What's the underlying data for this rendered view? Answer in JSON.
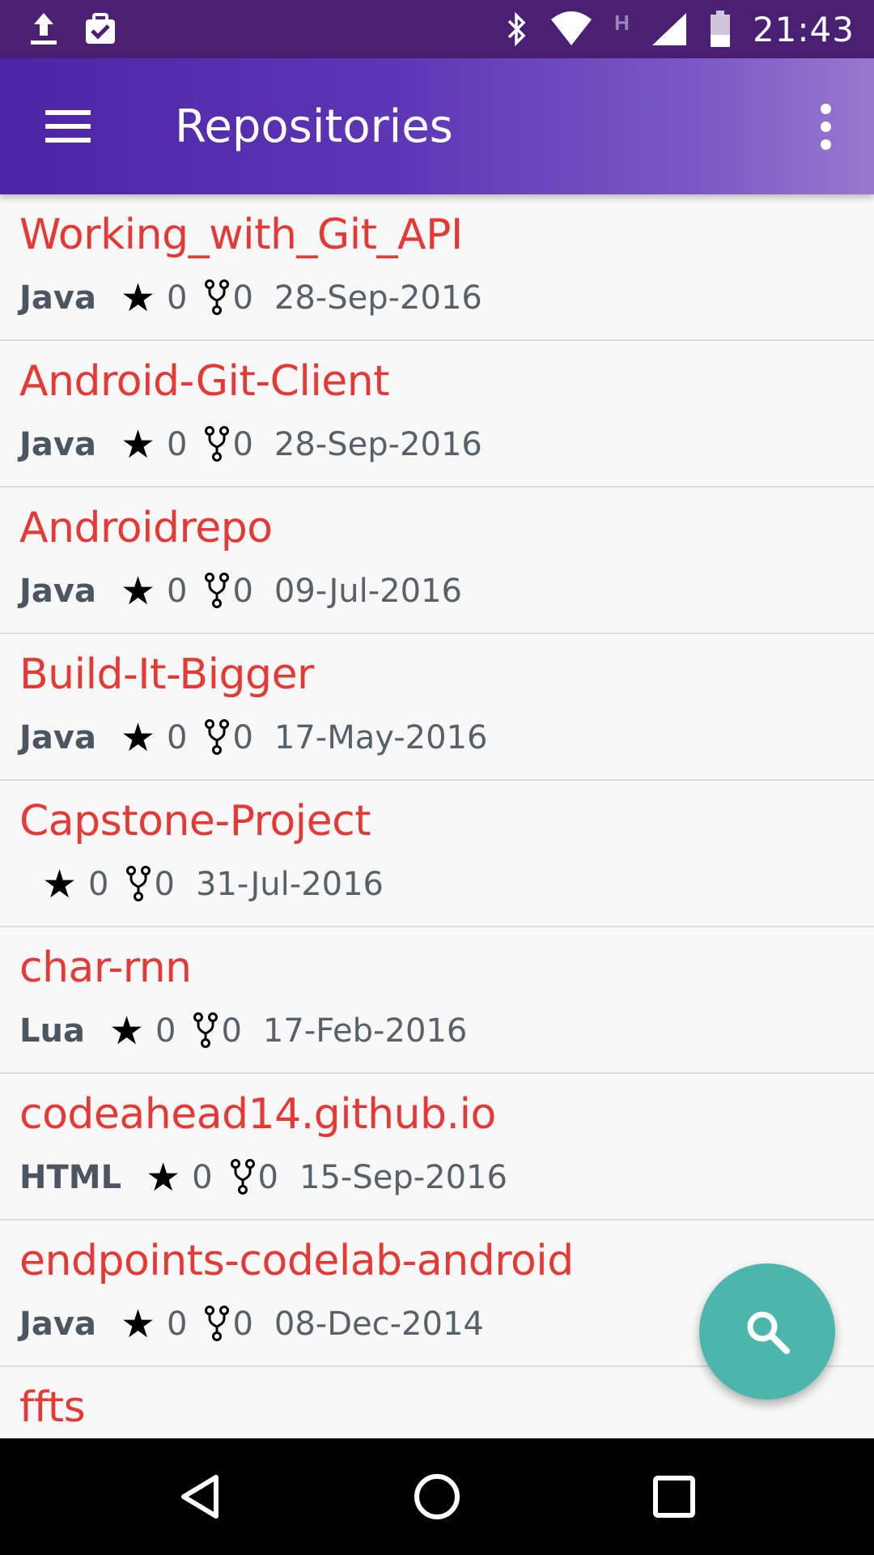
{
  "status_bar": {
    "time": "21:43",
    "left_icons": [
      "upload-icon",
      "clipboard-check-icon"
    ],
    "right_icons": [
      "bluetooth-icon",
      "wifi-icon",
      "h-network-icon",
      "signal-icon",
      "battery-icon"
    ],
    "network_type": "H"
  },
  "app_bar": {
    "title": "Repositories",
    "menu_icon": "hamburger-menu-icon",
    "overflow_icon": "more-vertical-icon",
    "gradient": [
      "#4b25a3",
      "#9878cf"
    ]
  },
  "repos": [
    {
      "name": "Working_with_Git_API",
      "language": "Java",
      "stars": "0",
      "forks": "0",
      "date": "28-Sep-2016"
    },
    {
      "name": "Android-Git-Client",
      "language": "Java",
      "stars": "0",
      "forks": "0",
      "date": "28-Sep-2016"
    },
    {
      "name": "Androidrepo",
      "language": "Java",
      "stars": "0",
      "forks": "0",
      "date": "09-Jul-2016"
    },
    {
      "name": "Build-It-Bigger",
      "language": "Java",
      "stars": "0",
      "forks": "0",
      "date": "17-May-2016"
    },
    {
      "name": "Capstone-Project",
      "language": "",
      "stars": "0",
      "forks": "0",
      "date": "31-Jul-2016"
    },
    {
      "name": "char-rnn",
      "language": "Lua",
      "stars": "0",
      "forks": "0",
      "date": "17-Feb-2016"
    },
    {
      "name": "codeahead14.github.io",
      "language": "HTML",
      "stars": "0",
      "forks": "0",
      "date": "15-Sep-2016"
    },
    {
      "name": "endpoints-codelab-android",
      "language": "Java",
      "stars": "0",
      "forks": "0",
      "date": "08-Dec-2014"
    },
    {
      "name": "ffts",
      "language": "",
      "stars": "",
      "forks": "",
      "date": ""
    }
  ],
  "fab": {
    "icon": "search-icon",
    "color": "#4db6ac"
  },
  "nav_bar": {
    "buttons": [
      "back-icon",
      "home-icon",
      "recents-icon"
    ]
  },
  "colors": {
    "repo_name": "#e53935",
    "status_bar": "#4a2072"
  }
}
